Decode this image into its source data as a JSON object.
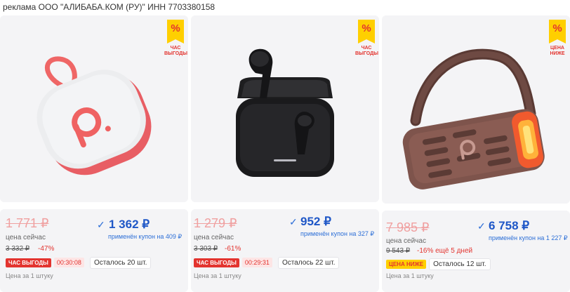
{
  "ad_text": "реклама ООО \"АЛИБАБА.КОМ (РУ)\" ИНН 7703380158",
  "accent_color": "#1f57c7",
  "sale_color": "#e3342f",
  "badge_color": "#ffcf00",
  "cards": [
    {
      "badge_symbol": "%",
      "badge_text": "ЧАС ВЫГОДЫ",
      "product_icon": "portable-speaker-white",
      "old_price": "1 771 ₽",
      "price_label": "цена сейчас",
      "base_price": "3 332 ₽",
      "discount": "-47%",
      "coupon_price": "1 362 ₽",
      "coupon_label": "применён купон на 409 ₽",
      "tag": "ЧАС ВЫГОДЫ",
      "timer": "00:30:08",
      "stock": "Осталось 20 шт.",
      "per_unit": "Цена за 1 штуку"
    },
    {
      "badge_symbol": "%",
      "badge_text": "ЧАС ВЫГОДЫ",
      "product_icon": "earbuds-case-black",
      "old_price": "1 279 ₽",
      "price_label": "цена сейчас",
      "base_price": "3 303 ₽",
      "discount": "-61%",
      "coupon_price": "952 ₽",
      "coupon_label": "применён купон на 327 ₽",
      "tag": "ЧАС ВЫГОДЫ",
      "timer": "00:29:31",
      "stock": "Осталось 22 шт.",
      "per_unit": "Цена за 1 штуку"
    },
    {
      "badge_symbol": "%",
      "badge_text": "ЦЕНА НИЖЕ",
      "product_icon": "outdoor-speaker-bronze",
      "old_price": "7 985 ₽",
      "price_label": "цена сейчас",
      "base_price": "9 543 ₽",
      "discount": "-16% ещё 5 дней",
      "coupon_price": "6 758 ₽",
      "coupon_label": "применён купон на 1 227 ₽",
      "tag": "ЦЕНА НИЖЕ",
      "stock": "Осталось 12 шт.",
      "per_unit": "Цена за 1 штуку"
    }
  ]
}
